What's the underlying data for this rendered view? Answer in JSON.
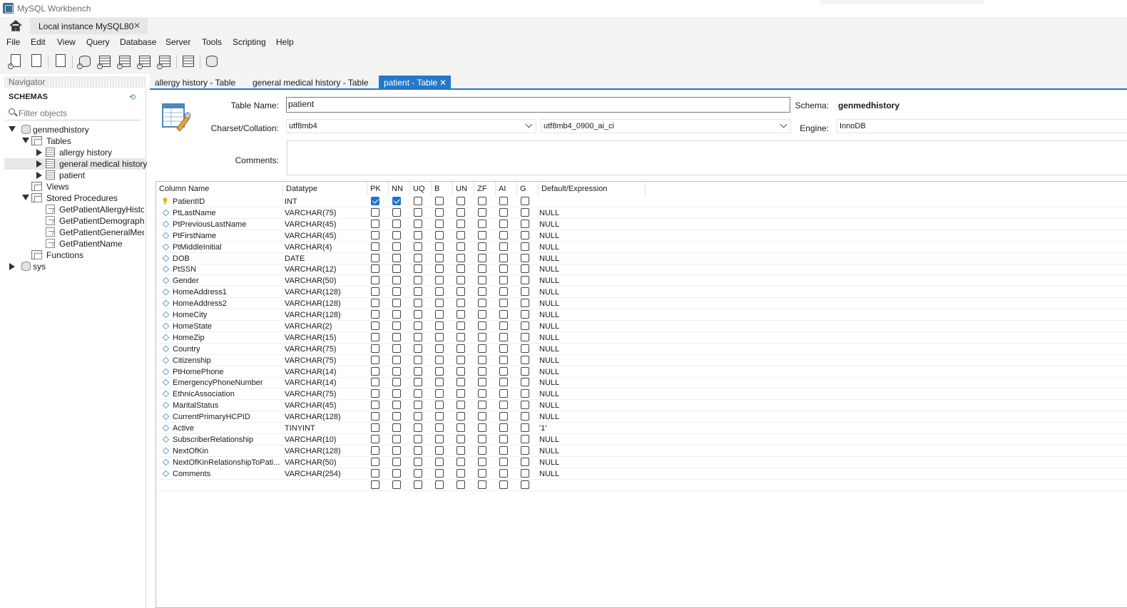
{
  "window": {
    "title": "MySQL Workbench"
  },
  "connection_tab": {
    "label": "Local instance MySQL80",
    "close": "✕"
  },
  "menu": [
    "File",
    "Edit",
    "View",
    "Query",
    "Database",
    "Server",
    "Tools",
    "Scripting",
    "Help"
  ],
  "navigator": {
    "header": "Navigator",
    "schemas_title": "SCHEMAS",
    "filter_placeholder": "Filter objects",
    "tree": {
      "db1": "genmedhistory",
      "tables": "Tables",
      "t1": "allergy history",
      "t2": "general medical history",
      "t3": "patient",
      "views": "Views",
      "procs": "Stored Procedures",
      "p1": "GetPatientAllergyHistory",
      "p2": "GetPatientDemographic",
      "p3": "GetPatientGeneralMedic",
      "p4": "GetPatientName",
      "functions": "Functions",
      "db2": "sys"
    }
  },
  "editor_tabs": {
    "t1": "allergy history - Table",
    "t2": "general medical history - Table",
    "t3": "patient - Table",
    "close": "✕"
  },
  "table_editor": {
    "table_name_label": "Table Name:",
    "table_name": "patient",
    "charset_label": "Charset/Collation:",
    "charset": "utf8mb4",
    "collation": "utf8mb4_0900_ai_ci",
    "schema_label": "Schema:",
    "schema": "genmedhistory",
    "engine_label": "Engine:",
    "engine": "InnoDB",
    "comments_label": "Comments:"
  },
  "grid": {
    "headers": {
      "name": "Column Name",
      "type": "Datatype",
      "pk": "PK",
      "nn": "NN",
      "uq": "UQ",
      "b": "B",
      "un": "UN",
      "zf": "ZF",
      "ai": "AI",
      "g": "G",
      "def": "Default/Expression"
    },
    "rows": [
      {
        "name": "PatientID",
        "type": "INT",
        "def": "",
        "pk": true,
        "nn": true,
        "key": true
      },
      {
        "name": "PtLastName",
        "type": "VARCHAR(75)",
        "def": "NULL"
      },
      {
        "name": "PtPreviousLastName",
        "type": "VARCHAR(45)",
        "def": "NULL"
      },
      {
        "name": "PtFirstName",
        "type": "VARCHAR(45)",
        "def": "NULL"
      },
      {
        "name": "PtMiddleInitial",
        "type": "VARCHAR(4)",
        "def": "NULL"
      },
      {
        "name": "DOB",
        "type": "DATE",
        "def": "NULL"
      },
      {
        "name": "PtSSN",
        "type": "VARCHAR(12)",
        "def": "NULL"
      },
      {
        "name": "Gender",
        "type": "VARCHAR(50)",
        "def": "NULL"
      },
      {
        "name": "HomeAddress1",
        "type": "VARCHAR(128)",
        "def": "NULL"
      },
      {
        "name": "HomeAddress2",
        "type": "VARCHAR(128)",
        "def": "NULL"
      },
      {
        "name": "HomeCity",
        "type": "VARCHAR(128)",
        "def": "NULL"
      },
      {
        "name": "HomeState",
        "type": "VARCHAR(2)",
        "def": "NULL"
      },
      {
        "name": "HomeZip",
        "type": "VARCHAR(15)",
        "def": "NULL"
      },
      {
        "name": "Country",
        "type": "VARCHAR(75)",
        "def": "NULL"
      },
      {
        "name": "Citizenship",
        "type": "VARCHAR(75)",
        "def": "NULL"
      },
      {
        "name": "PtHomePhone",
        "type": "VARCHAR(14)",
        "def": "NULL"
      },
      {
        "name": "EmergencyPhoneNumber",
        "type": "VARCHAR(14)",
        "def": "NULL"
      },
      {
        "name": "EthnicAssociation",
        "type": "VARCHAR(75)",
        "def": "NULL"
      },
      {
        "name": "MaritalStatus",
        "type": "VARCHAR(45)",
        "def": "NULL"
      },
      {
        "name": "CurrentPrimaryHCPID",
        "type": "VARCHAR(128)",
        "def": "NULL"
      },
      {
        "name": "Active",
        "type": "TINYINT",
        "def": "'1'"
      },
      {
        "name": "SubscriberRelationship",
        "type": "VARCHAR(10)",
        "def": "NULL"
      },
      {
        "name": "NextOfKin",
        "type": "VARCHAR(128)",
        "def": "NULL"
      },
      {
        "name": "NextOfKinRelationshipToPati...",
        "type": "VARCHAR(50)",
        "def": "NULL"
      },
      {
        "name": "Comments",
        "type": "VARCHAR(254)",
        "def": "NULL"
      },
      {
        "name": "",
        "type": "",
        "def": ""
      }
    ]
  },
  "colors": {
    "accent": "#2478c8",
    "check": "#1e75c7",
    "key": "#e2b100"
  }
}
